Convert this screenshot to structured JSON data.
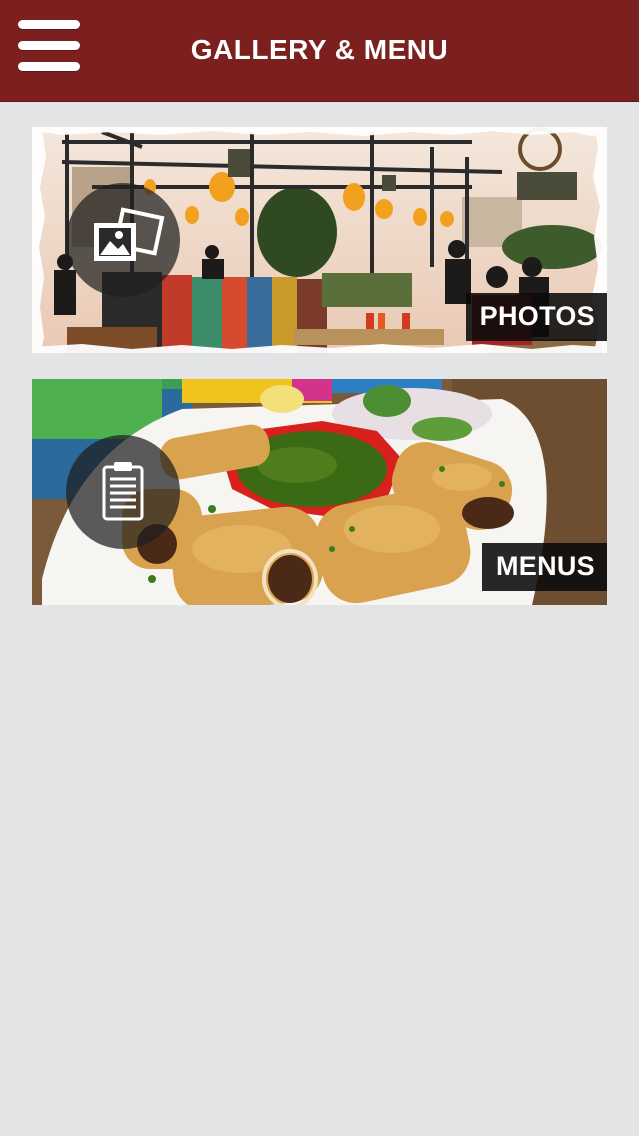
{
  "header": {
    "title": "GALLERY & MENU",
    "menu_icon": "hamburger-menu-icon",
    "background_color": "#7c1f1f"
  },
  "cards": [
    {
      "label": "PHOTOS",
      "icon": "photo-gallery-icon"
    },
    {
      "label": "MENUS",
      "icon": "clipboard-icon"
    }
  ]
}
